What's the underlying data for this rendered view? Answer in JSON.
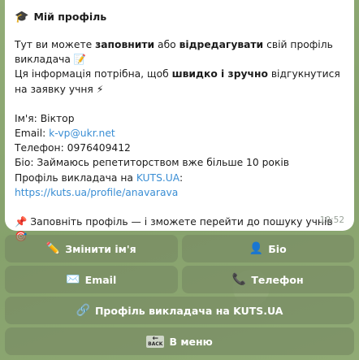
{
  "message": {
    "title_icon": "🎓",
    "title": "Мій профіль",
    "intro": {
      "t1": "Тут ви можете ",
      "b1": "заповнити",
      "t2": " або ",
      "b2": "відредагувати",
      "t3": " свій профіль викладача ",
      "e1": "📝"
    },
    "intro2": {
      "t1": "Ця інформація потрібна, щоб ",
      "b1": "швидко і зручно",
      "t2": " відгукнутися на заявку учня ",
      "e1": "⚡"
    },
    "fields": {
      "name": "Ім'я: Віктор",
      "email_label": "Email: ",
      "email": "k-vp@ukr.net",
      "phone": "Телефон: 0976409412",
      "bio": "Біо: Займаюсь репетиторством вже більше 10 років",
      "profile_label": "Профіль викладача на ",
      "kuts": "KUTS.UA",
      "colon": ": ",
      "profile_url": "https://kuts.ua/profile/anavarava"
    },
    "hint": {
      "pin": "📌",
      "text": " Заповніть профіль — і зможете перейти до пошуку учнів ",
      "target": "🎯"
    },
    "time": "10:52"
  },
  "keyboard": {
    "change_name": {
      "icon": "✏️",
      "label": "Змінити ім'я"
    },
    "bio": {
      "icon": "👤",
      "label": "Біо"
    },
    "email": {
      "icon": "✉️",
      "label": "Email"
    },
    "phone": {
      "icon": "📞",
      "label": "Телефон"
    },
    "profile": {
      "icon": "🔗",
      "label": "Профіль викладача на KUTS.UA"
    },
    "back": {
      "icon_text": "BACK",
      "label": "В меню"
    }
  }
}
